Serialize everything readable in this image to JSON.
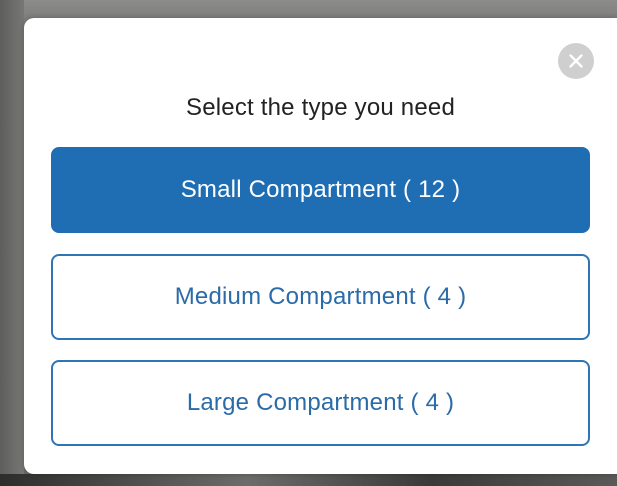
{
  "dialog": {
    "title": "Select the type you need",
    "close_icon": "close-icon",
    "options": [
      {
        "label": "Small Compartment ( 12 )",
        "selected": true
      },
      {
        "label": "Medium Compartment ( 4 )",
        "selected": false
      },
      {
        "label": "Large Compartment ( 4 )",
        "selected": false
      }
    ]
  },
  "colors": {
    "accent": "#1f6db3",
    "accent_text": "#2a6ba8",
    "close_bg": "#cfcfcf"
  }
}
